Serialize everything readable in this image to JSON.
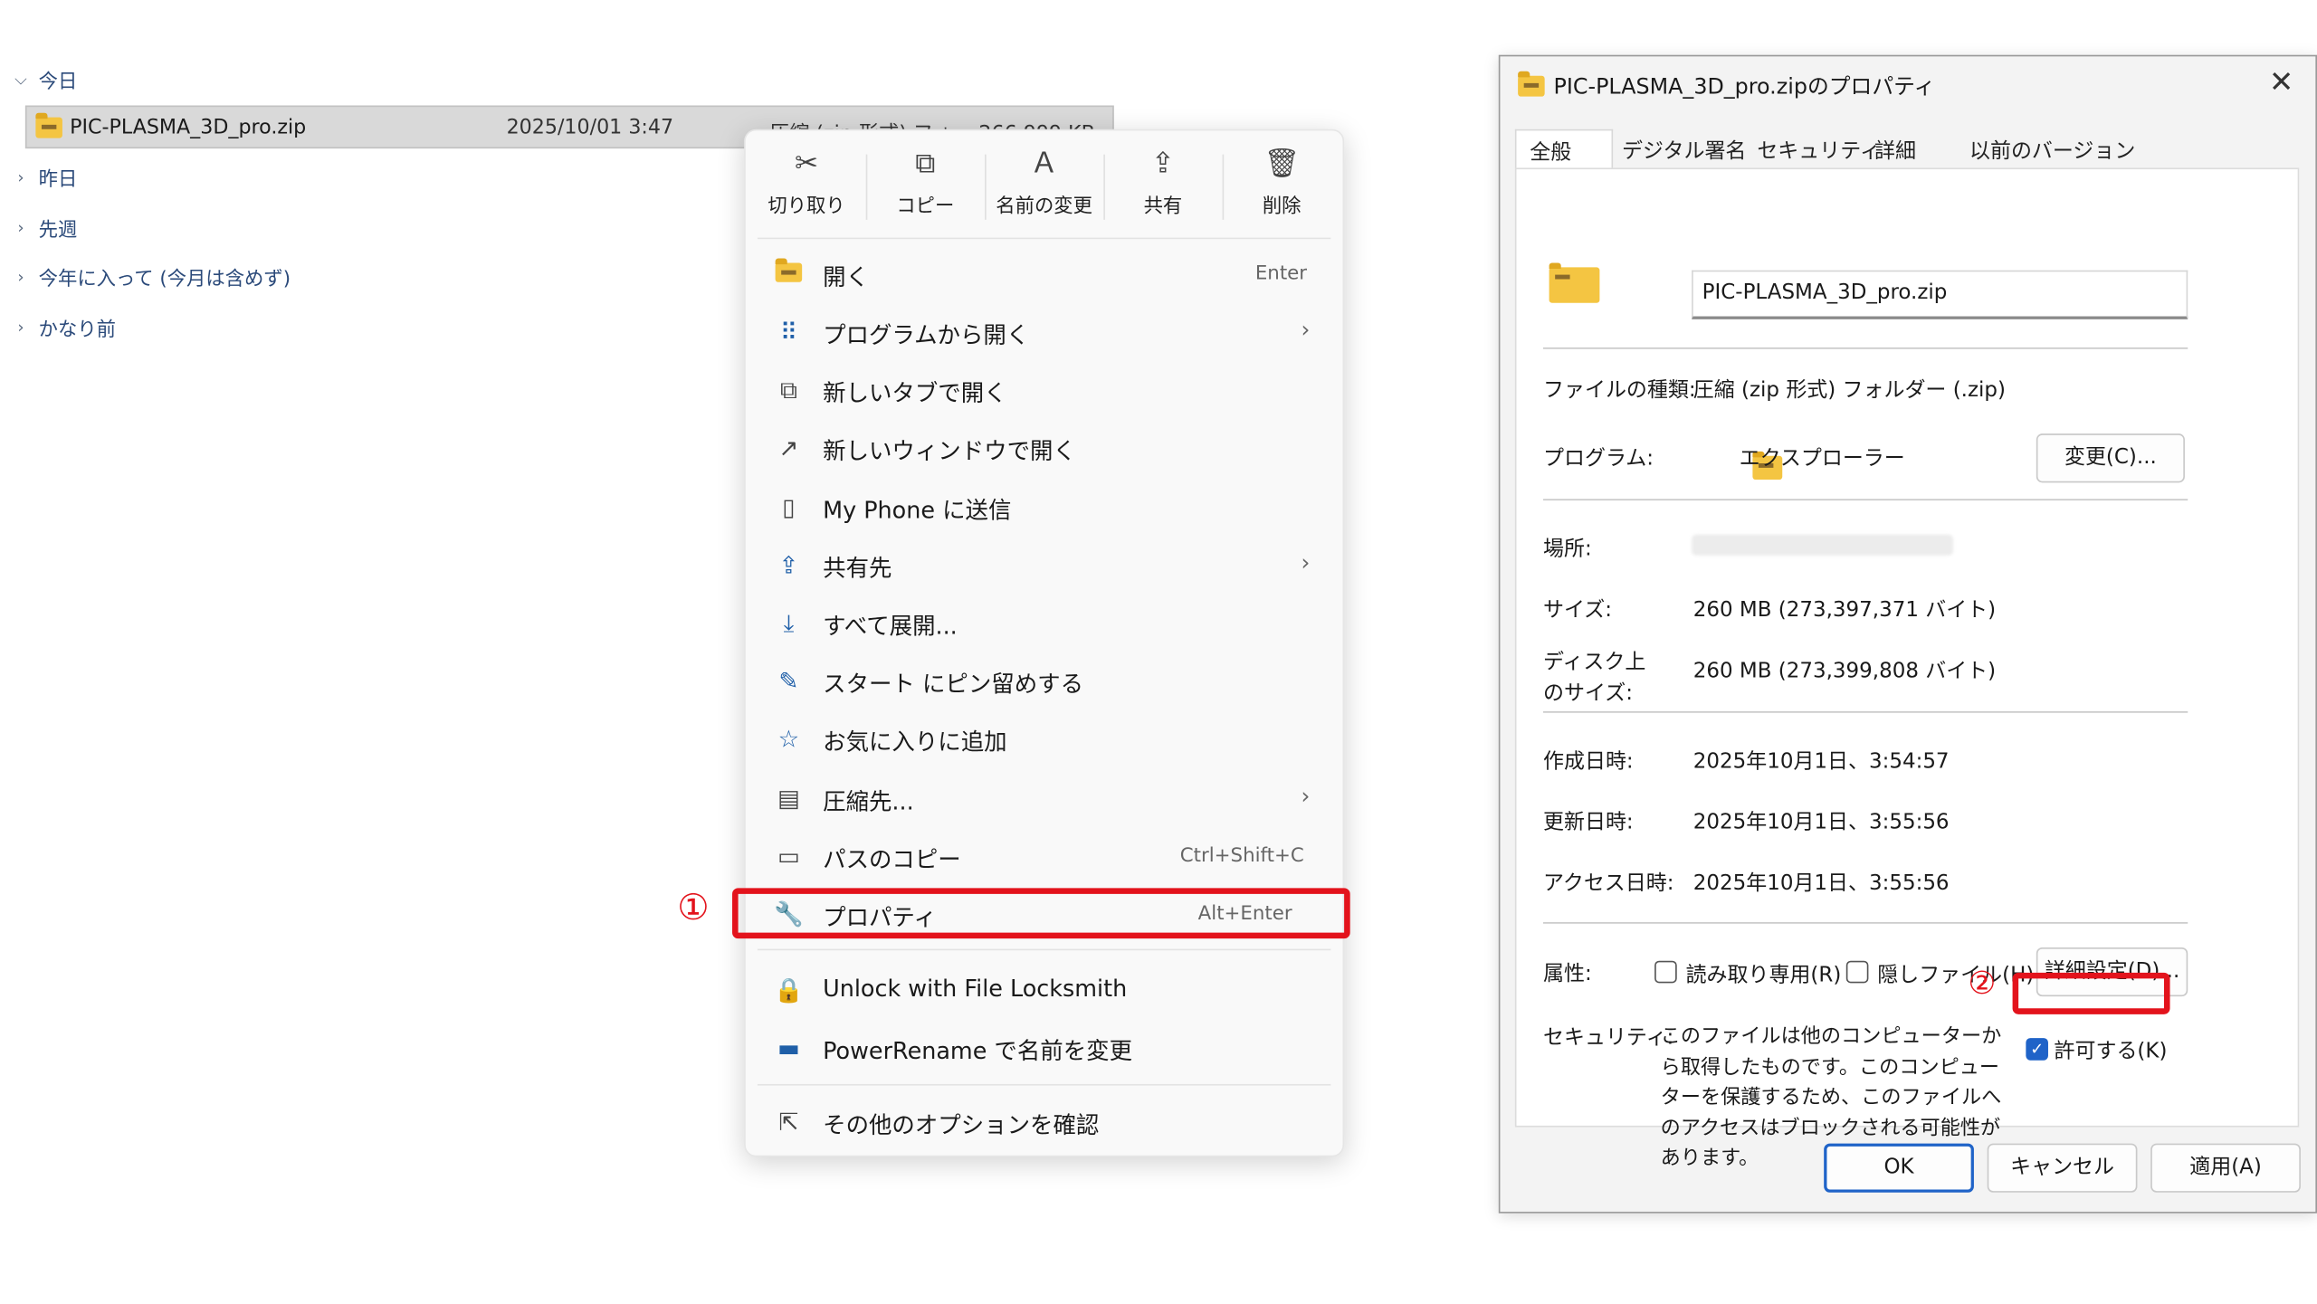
{
  "explorer": {
    "groups": {
      "today": "今日",
      "yesterday": "昨日",
      "last_week": "先週",
      "this_year": "今年に入って (今月は含めず)",
      "long_ago": "かなり前"
    },
    "file": {
      "name": "PIC-PLASMA_3D_pro.zip",
      "date": "2025/10/01 3:47",
      "type_partial": "圧縮 (zip 形式) フォ... 266,999 KB"
    }
  },
  "context_menu": {
    "toolbar": {
      "cut": "切り取り",
      "copy": "コピー",
      "rename": "名前の変更",
      "share": "共有",
      "delete": "削除"
    },
    "items": {
      "open": "開く",
      "open_shortcut": "Enter",
      "open_with": "プログラムから開く",
      "open_new_tab": "新しいタブで開く",
      "open_new_window": "新しいウィンドウで開く",
      "send_phone": "My Phone に送信",
      "share_with": "共有先",
      "extract_all": "すべて展開...",
      "pin_start": "スタート にピン留めする",
      "add_favorites": "お気に入りに追加",
      "compress_to": "圧縮先...",
      "copy_path": "パスのコピー",
      "copy_path_shortcut": "Ctrl+Shift+C",
      "properties": "プロパティ",
      "properties_shortcut": "Alt+Enter",
      "unlock": "Unlock with File Locksmith",
      "power_rename": "PowerRename で名前を変更",
      "more_options": "その他のオプションを確認"
    }
  },
  "annotations": {
    "step1": "①",
    "step2": "②"
  },
  "properties_dialog": {
    "title": "PIC-PLASMA_3D_pro.zipのプロパティ",
    "tabs": {
      "general": "全般",
      "digital_signature": "デジタル署名",
      "security": "セキュリティ",
      "details": "詳細",
      "previous_versions": "以前のバージョン"
    },
    "file_name": "PIC-PLASMA_3D_pro.zip",
    "labels": {
      "file_type": "ファイルの種類:",
      "program": "プログラム:",
      "location": "場所:",
      "size": "サイズ:",
      "disk_size_1": "ディスク上",
      "disk_size_2": "のサイズ:",
      "created": "作成日時:",
      "modified": "更新日時:",
      "accessed": "アクセス日時:",
      "attributes": "属性:",
      "security": "セキュリティ:"
    },
    "values": {
      "file_type": "圧縮 (zip 形式) フォルダー (.zip)",
      "program": "エクスプローラー",
      "size": "260 MB (273,397,371 バイト)",
      "disk_size": "260 MB (273,399,808 バイト)",
      "created": "2025年10月1日、3:54:57",
      "modified": "2025年10月1日、3:55:56",
      "accessed": "2025年10月1日、3:55:56"
    },
    "buttons": {
      "change": "変更(C)...",
      "advanced": "詳細設定(D)...",
      "ok": "OK",
      "cancel": "キャンセル",
      "apply": "適用(A)"
    },
    "checkboxes": {
      "read_only": "読み取り専用(R)",
      "hidden": "隠しファイル(H)",
      "unblock": "許可する(K)"
    },
    "security_text": "このファイルは他のコンピューターから取得したものです。このコンピューターを保護するため、このファイルへのアクセスはブロックされる可能性があります。"
  },
  "colors": {
    "highlight_red": "#e3131c",
    "accent_blue": "#1f63c8"
  }
}
